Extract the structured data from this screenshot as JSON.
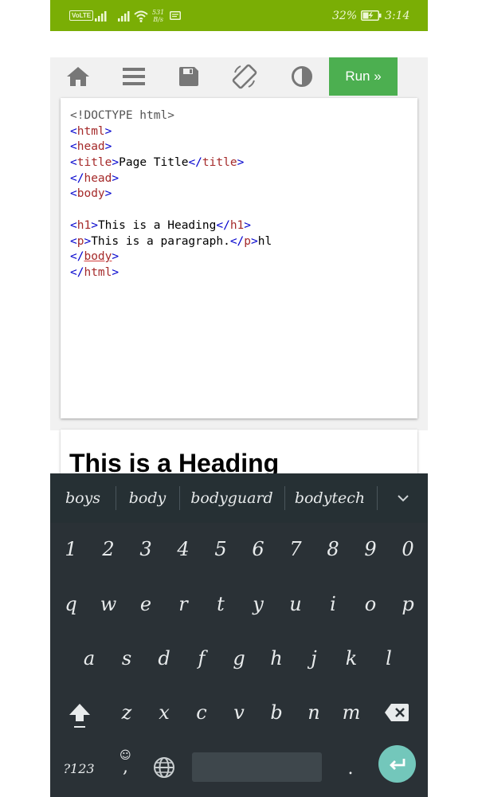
{
  "status_bar": {
    "volte": "VoLTE",
    "net_speed_value": "531",
    "net_speed_unit": "B/s",
    "battery_percent": "32%",
    "time": "3:14"
  },
  "toolbar": {
    "run_label": "Run »"
  },
  "editor": {
    "lines": [
      [
        {
          "t": "<!DOCTYPE html>",
          "c": "doc"
        }
      ],
      [
        {
          "t": "<",
          "c": "br"
        },
        {
          "t": "html",
          "c": "tag"
        },
        {
          "t": ">",
          "c": "br"
        }
      ],
      [
        {
          "t": "<",
          "c": "br"
        },
        {
          "t": "head",
          "c": "tag"
        },
        {
          "t": ">",
          "c": "br"
        }
      ],
      [
        {
          "t": "<",
          "c": "br"
        },
        {
          "t": "title",
          "c": "tag"
        },
        {
          "t": ">",
          "c": "br"
        },
        {
          "t": "Page Title",
          "c": "txt"
        },
        {
          "t": "</",
          "c": "br"
        },
        {
          "t": "title",
          "c": "tag"
        },
        {
          "t": ">",
          "c": "br"
        }
      ],
      [
        {
          "t": "</",
          "c": "br"
        },
        {
          "t": "head",
          "c": "tag"
        },
        {
          "t": ">",
          "c": "br"
        }
      ],
      [
        {
          "t": "<",
          "c": "br"
        },
        {
          "t": "body",
          "c": "tag"
        },
        {
          "t": ">",
          "c": "br"
        }
      ],
      [],
      [
        {
          "t": "<",
          "c": "br"
        },
        {
          "t": "h1",
          "c": "tag"
        },
        {
          "t": ">",
          "c": "br"
        },
        {
          "t": "This is a Heading",
          "c": "txt"
        },
        {
          "t": "</",
          "c": "br"
        },
        {
          "t": "h1",
          "c": "tag"
        },
        {
          "t": ">",
          "c": "br"
        }
      ],
      [
        {
          "t": "<",
          "c": "br"
        },
        {
          "t": "p",
          "c": "tag"
        },
        {
          "t": ">",
          "c": "br"
        },
        {
          "t": "This is a paragraph.",
          "c": "txt"
        },
        {
          "t": "</",
          "c": "br"
        },
        {
          "t": "p",
          "c": "tag"
        },
        {
          "t": ">",
          "c": "br"
        },
        {
          "t": "hl",
          "c": "txt"
        }
      ],
      [
        {
          "t": "</",
          "c": "br"
        },
        {
          "t": "body",
          "c": "tag",
          "squiggle": true
        },
        {
          "t": ">",
          "c": "br"
        }
      ],
      [
        {
          "t": "</",
          "c": "br"
        },
        {
          "t": "html",
          "c": "tag"
        },
        {
          "t": ">",
          "c": "br"
        }
      ]
    ]
  },
  "result": {
    "heading": "This is a Heading"
  },
  "keyboard": {
    "suggestions": [
      "boys",
      "body",
      "bodyguard",
      "bodytech"
    ],
    "number_row": [
      "1",
      "2",
      "3",
      "4",
      "5",
      "6",
      "7",
      "8",
      "9",
      "0"
    ],
    "row_q": [
      "q",
      "w",
      "e",
      "r",
      "t",
      "y",
      "u",
      "i",
      "o",
      "p"
    ],
    "row_a": [
      "a",
      "s",
      "d",
      "f",
      "g",
      "h",
      "j",
      "k",
      "l"
    ],
    "row_z": [
      "z",
      "x",
      "c",
      "v",
      "b",
      "n",
      "m"
    ],
    "symbols_label": "?123",
    "comma_label": ",",
    "period_label": "."
  },
  "colors": {
    "status_bar": "#7aae05",
    "run_button": "#4caf50",
    "keyboard_bg": "#2a3136",
    "enter_key": "#73c7bb",
    "tag": "#a52a2a",
    "bracket": "#0000cd"
  }
}
